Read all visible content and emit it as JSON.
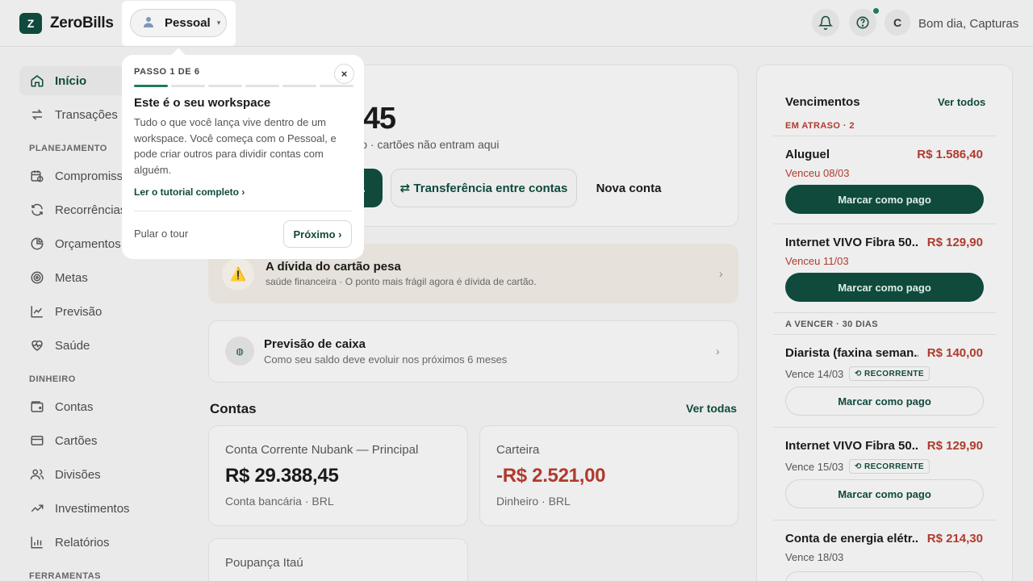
{
  "app": {
    "logo_letter": "Z",
    "name": "ZeroBills"
  },
  "header": {
    "workspace_label": "Pessoal",
    "avatar_initial": "C",
    "greeting": "Bom dia, Capturas"
  },
  "sidebar": {
    "items": [
      {
        "label": "Início"
      },
      {
        "label": "Transações"
      }
    ],
    "section_planning": "PLANEJAMENTO",
    "planning_items": [
      {
        "label": "Compromissos"
      },
      {
        "label": "Recorrências"
      },
      {
        "label": "Orçamentos"
      },
      {
        "label": "Metas"
      },
      {
        "label": "Previsão"
      },
      {
        "label": "Saúde"
      }
    ],
    "section_money": "DINHEIRO",
    "money_items": [
      {
        "label": "Contas"
      },
      {
        "label": "Cartões"
      },
      {
        "label": "Divisões"
      },
      {
        "label": "Investimentos"
      },
      {
        "label": "Relatórios"
      }
    ],
    "section_tools": "FERRAMENTAS"
  },
  "main": {
    "balance_partial": "7,45",
    "balance_sub_partial": "mado · cartões não entram aqui",
    "transfer_button": "⇄ Transferência entre contas",
    "new_account_button": "Nova conta",
    "alert": {
      "title": "A dívida do cartão pesa",
      "subtitle": "saúde financeira · O ponto mais frágil agora é dívida de cartão."
    },
    "forecast": {
      "title": "Previsão de caixa",
      "subtitle": "Como seu saldo deve evoluir nos próximos 6 meses"
    },
    "accounts_title": "Contas",
    "accounts_link": "Ver todas",
    "accounts": [
      {
        "name": "Conta Corrente Nubank — Principal",
        "amount": "R$ 29.388,45",
        "meta": "Conta bancária · BRL"
      },
      {
        "name": "Carteira",
        "amount": "-R$ 2.521,00",
        "meta": "Dinheiro · BRL"
      },
      {
        "name": "Poupança Itaú"
      }
    ]
  },
  "due_panel": {
    "title": "Vencimentos",
    "link": "Ver todos",
    "overdue_label": "EM ATRASO · 2",
    "upcoming_label": "A VENCER · 30 DIAS",
    "pay_label": "Marcar como pago",
    "recurring_tag": "⟲ RECORRENTE",
    "bills": [
      {
        "name": "Aluguel",
        "amount": "R$ 1.586,40",
        "due": "Venceu 08/03"
      },
      {
        "name": "Internet VIVO Fibra 50...",
        "amount": "R$ 129,90",
        "due": "Venceu 11/03"
      },
      {
        "name": "Diarista (faxina seman...",
        "amount": "R$ 140,00",
        "due": "Vence 14/03"
      },
      {
        "name": "Internet VIVO Fibra 50...",
        "amount": "R$ 129,90",
        "due": "Vence 15/03"
      },
      {
        "name": "Conta de energia elétr...",
        "amount": "R$ 214,30",
        "due": "Vence 18/03"
      }
    ]
  },
  "tour": {
    "step": "PASSO 1 DE 6",
    "step_current": 1,
    "step_total": 6,
    "close": "×",
    "title": "Este é o seu workspace",
    "body": "Tudo o que você lança vive dentro de um workspace. Você começa com o Pessoal, e pode criar outros para dividir contas com alguém.",
    "link": "Ler o tutorial completo ›",
    "skip": "Pular o tour",
    "next": "Próximo ›"
  },
  "colors": {
    "brand": "#0f4a3c",
    "danger": "#b03a2e",
    "accent": "#1f7a5c"
  }
}
